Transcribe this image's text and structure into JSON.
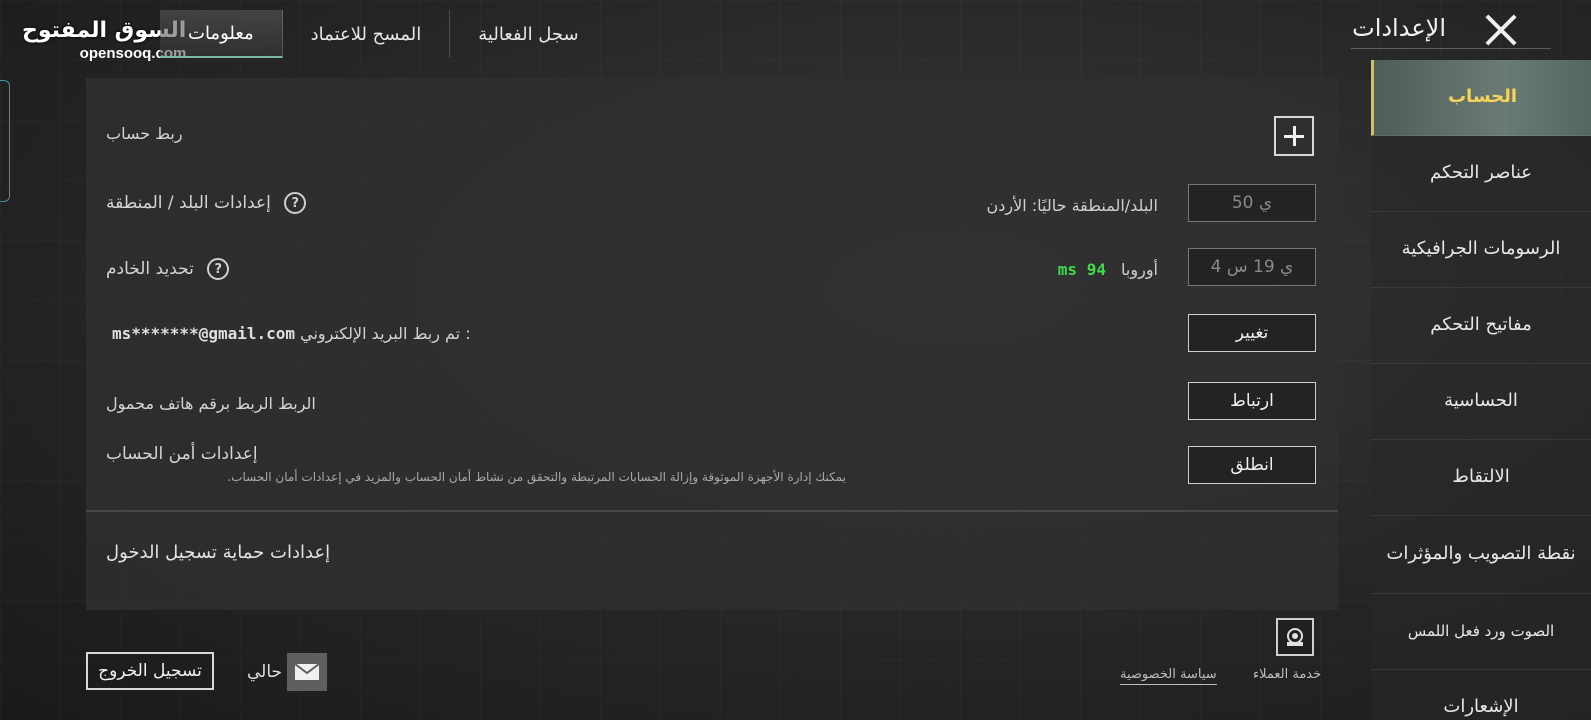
{
  "watermark": {
    "arabic": "السوق المفتوح",
    "english": "opensooq.com"
  },
  "header": {
    "title": "الإعدادات",
    "tabs": [
      {
        "label": "معلومات",
        "active": true
      },
      {
        "label": "المسح للاعتماد",
        "active": false
      },
      {
        "label": "سجل الفعالية",
        "active": false
      }
    ]
  },
  "sidebar": {
    "items": [
      {
        "label": "الحساب",
        "active": true
      },
      {
        "label": "عناصر التحكم"
      },
      {
        "label": "الرسومات الجرافيكية"
      },
      {
        "label": "مفاتيح التحكم"
      },
      {
        "label": "الحساسية"
      },
      {
        "label": "الالتقاط"
      },
      {
        "label": "نقطة التصويب والمؤثرات"
      },
      {
        "label": "الصوت ورد فعل اللمس"
      },
      {
        "label": "الإشعارات"
      }
    ]
  },
  "account": {
    "link_account": {
      "label": "ربط حساب"
    },
    "region": {
      "label": "إعدادات البلد / المنطقة",
      "current": "البلد/المنطقة حاليًا: الأردن",
      "button": "50 ي"
    },
    "server": {
      "label": "تحديد الخادم",
      "current": "أوروبا",
      "ping": "94 ms",
      "button": "4 ي 19 س"
    },
    "email": {
      "label": "تم ربط البريد الإلكتروني :",
      "value": "ms*******@gmail.com",
      "button": "تغيير"
    },
    "phone": {
      "label": "الربط الربط برقم هاتف محمول",
      "button": "ارتباط"
    },
    "security": {
      "label": "إعدادات أمن الحساب",
      "description": "يمكنك إدارة الأجهزة الموثوقة وإزالة الحسابات المرتبطة والتحقق من نشاط أمان الحساب والمزيد في إعدادات أمان الحساب.",
      "button": "انطلق"
    },
    "login_protection": {
      "title": "إعدادات حماية تسجيل الدخول"
    }
  },
  "footer": {
    "logout": "تسجيل الخروج",
    "status": "حالي",
    "privacy": "سياسة الخصوصية",
    "support": "خدمة العملاء"
  },
  "colors": {
    "ping": "#3cdc4a",
    "active_tab_text": "#f4d55a"
  }
}
